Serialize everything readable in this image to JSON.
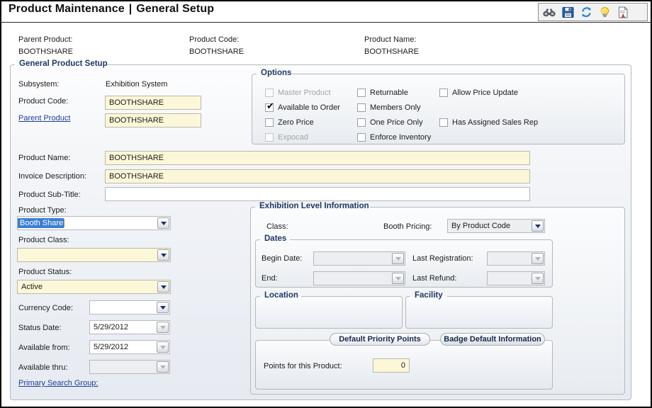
{
  "window": {
    "title_main": "Product Maintenance",
    "title_sep": "|",
    "title_sub": "General Setup"
  },
  "toolbar": {
    "items": [
      {
        "name": "binoculars-icon",
        "tooltip": "Find"
      },
      {
        "name": "save-icon",
        "tooltip": "Save"
      },
      {
        "name": "refresh-icon",
        "tooltip": "Refresh"
      },
      {
        "name": "lightbulb-icon",
        "tooltip": "Hint"
      },
      {
        "name": "report-icon",
        "tooltip": "Report"
      }
    ]
  },
  "header": {
    "parent_product_label": "Parent Product:",
    "parent_product_value": "BOOTHSHARE",
    "product_code_label": "Product Code:",
    "product_code_value": "BOOTHSHARE",
    "product_name_label": "Product Name:",
    "product_name_value": "BOOTHSHARE"
  },
  "general_setup": {
    "legend": "General Product Setup",
    "subsystem_label": "Subsystem:",
    "subsystem_value": "Exhibition System",
    "product_code_label": "Product Code:",
    "product_code_value": "BOOTHSHARE",
    "parent_product_link": "Parent Product",
    "parent_product_value": "BOOTHSHARE",
    "product_name_label": "Product Name:",
    "product_name_value": "BOOTHSHARE",
    "invoice_description_label": "Invoice Description:",
    "invoice_description_value": "BOOTHSHARE",
    "product_subtitle_label": "Product Sub-Title:",
    "product_subtitle_value": "",
    "product_type_label": "Product Type:",
    "product_type_value": "Booth Share",
    "product_class_label": "Product Class:",
    "product_class_value": "",
    "product_status_label": "Product Status:",
    "product_status_value": "Active",
    "currency_code_label": "Currency Code:",
    "currency_code_value": "",
    "status_date_label": "Status Date:",
    "status_date_value": "5/29/2012",
    "available_from_label": "Available from:",
    "available_from_value": "5/29/2012",
    "available_thru_label": "Available thru:",
    "available_thru_value": "",
    "primary_search_group_link": "Primary Search Group:"
  },
  "options": {
    "legend": "Options",
    "col1": [
      {
        "label": "Master Product",
        "checked": false,
        "disabled": true
      },
      {
        "label": "Available to Order",
        "checked": true,
        "disabled": false
      },
      {
        "label": "Zero Price",
        "checked": false,
        "disabled": false
      },
      {
        "label": "Expocad",
        "checked": false,
        "disabled": true
      }
    ],
    "col2": [
      {
        "label": "Returnable",
        "checked": false,
        "disabled": false
      },
      {
        "label": "Members Only",
        "checked": false,
        "disabled": false
      },
      {
        "label": "One Price Only",
        "checked": false,
        "disabled": false
      },
      {
        "label": "Enforce Inventory",
        "checked": false,
        "disabled": false
      }
    ],
    "col3": [
      {
        "label": "Allow Price Update",
        "checked": false,
        "disabled": false
      },
      {
        "label": "Has Assigned Sales Rep",
        "checked": false,
        "disabled": false
      }
    ]
  },
  "exhibition": {
    "legend": "Exhibition Level Information",
    "class_label": "Class:",
    "booth_pricing_label": "Booth Pricing:",
    "booth_pricing_value": "By Product Code",
    "dates_legend": "Dates",
    "begin_date_label": "Begin Date:",
    "begin_date_value": "",
    "end_label": "End:",
    "end_value": "",
    "last_registration_label": "Last Registration:",
    "last_registration_value": "",
    "last_refund_label": "Last Refund:",
    "last_refund_value": "",
    "location_legend": "Location",
    "facility_legend": "Facility",
    "tabs": [
      {
        "label": "Default Priority Points",
        "active": true
      },
      {
        "label": "Badge Default Information",
        "active": false
      }
    ],
    "points_label": "Points for this Product:",
    "points_value": "0"
  },
  "colors": {
    "accent_blue": "#1f3864",
    "link_blue": "#1f3d99",
    "field_yellow": "#fcf7d8",
    "selection_blue": "#3a7fd5",
    "panel_bg": "#eef1f5"
  }
}
